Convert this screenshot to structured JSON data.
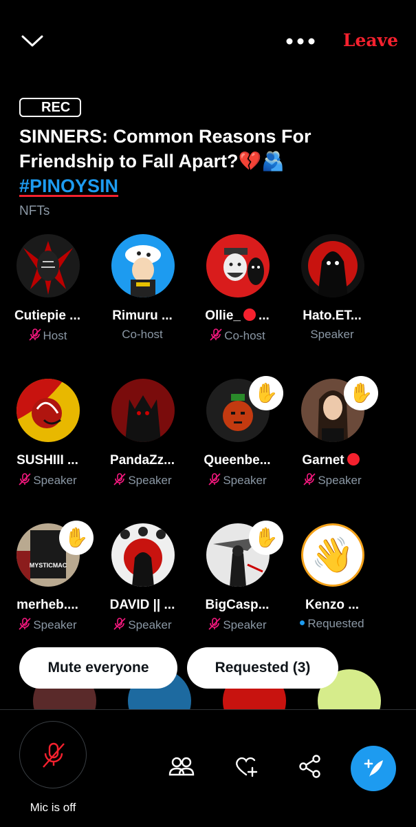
{
  "header": {
    "leave_label": "Leave",
    "rec_label": "REC"
  },
  "space": {
    "title": "SINNERS: Common Reasons For Friendship  to Fall Apart?💔🫂",
    "hashtag": "#PINOYSIN",
    "topic": "NFTs"
  },
  "participants": [
    {
      "name": "Cutiepie ...",
      "role": "Host",
      "muted": true
    },
    {
      "name": "Rimuru ...",
      "role": "Co-host",
      "muted": false
    },
    {
      "name": "Ollie_",
      "name_suffix": "...",
      "role": "Co-host",
      "muted": true
    },
    {
      "name": "Hato.ET...",
      "role": "Speaker",
      "muted": false
    },
    {
      "name": "SUSHIII ...",
      "role": "Speaker",
      "muted": true
    },
    {
      "name": "PandaZz...",
      "role": "Speaker",
      "muted": true
    },
    {
      "name": "Queenbe...",
      "role": "Speaker",
      "muted": true,
      "hand": "✋"
    },
    {
      "name": "Garnet",
      "role": "Speaker",
      "muted": true,
      "hand": "✋"
    },
    {
      "name": "merheb....",
      "role": "Speaker",
      "muted": true,
      "hand": "✋",
      "avatar_text": "MYSTICMAC"
    },
    {
      "name": "DAVID || ...",
      "role": "Speaker",
      "muted": true
    },
    {
      "name": "BigCasp...",
      "role": "Speaker",
      "muted": true,
      "hand": "✋"
    },
    {
      "name": "Kenzo ...",
      "role": "Requested",
      "muted": false,
      "avatar_emoji": "👋"
    }
  ],
  "actions": {
    "mute_everyone": "Mute everyone",
    "requested": "Requested (3)"
  },
  "bottom": {
    "mic_label": "Mic is off"
  },
  "colors": {
    "accent": "#1d9bf0",
    "danger": "#f4212e",
    "muted_icon": "#f91880"
  }
}
